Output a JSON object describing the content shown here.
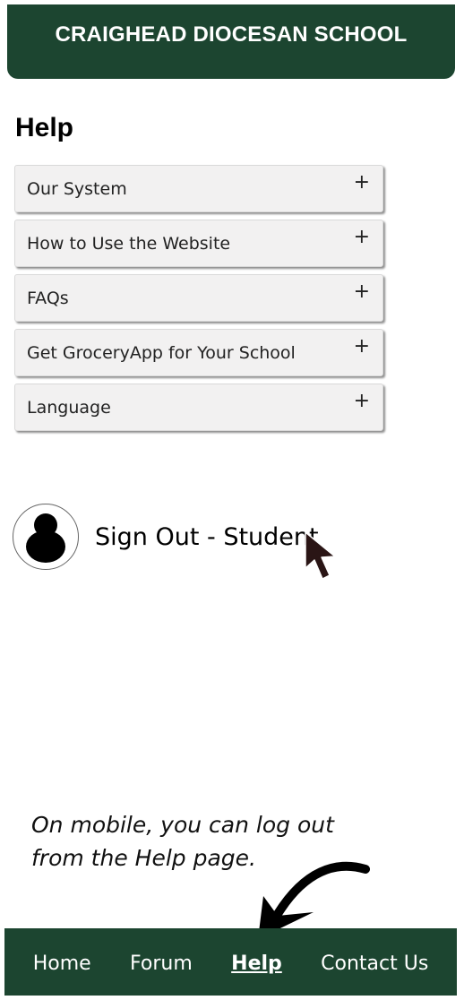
{
  "header": {
    "title": "CRAIGHEAD DIOCESAN SCHOOL"
  },
  "page": {
    "title": "Help"
  },
  "accordion": {
    "items": [
      {
        "label": "Our System",
        "icon": "plus-icon"
      },
      {
        "label": "How to Use the Website",
        "icon": "plus-icon"
      },
      {
        "label": "FAQs",
        "icon": "plus-icon"
      },
      {
        "label": "Get GroceryApp for Your School",
        "icon": "plus-icon"
      },
      {
        "label": "Language",
        "icon": "plus-icon"
      }
    ],
    "expand_symbol": "+"
  },
  "signout": {
    "label": "Sign Out - Student",
    "icon": "user-avatar-icon"
  },
  "caption": {
    "text": "On mobile, you can log out from the Help page."
  },
  "nav": {
    "items": [
      {
        "label": "Home",
        "active": false
      },
      {
        "label": "Forum",
        "active": false
      },
      {
        "label": "Help",
        "active": true
      },
      {
        "label": "Contact Us",
        "active": false
      }
    ]
  },
  "colors": {
    "brand": "#1c4530",
    "accordion_bg": "#f2f1f1",
    "text": "#111111"
  }
}
